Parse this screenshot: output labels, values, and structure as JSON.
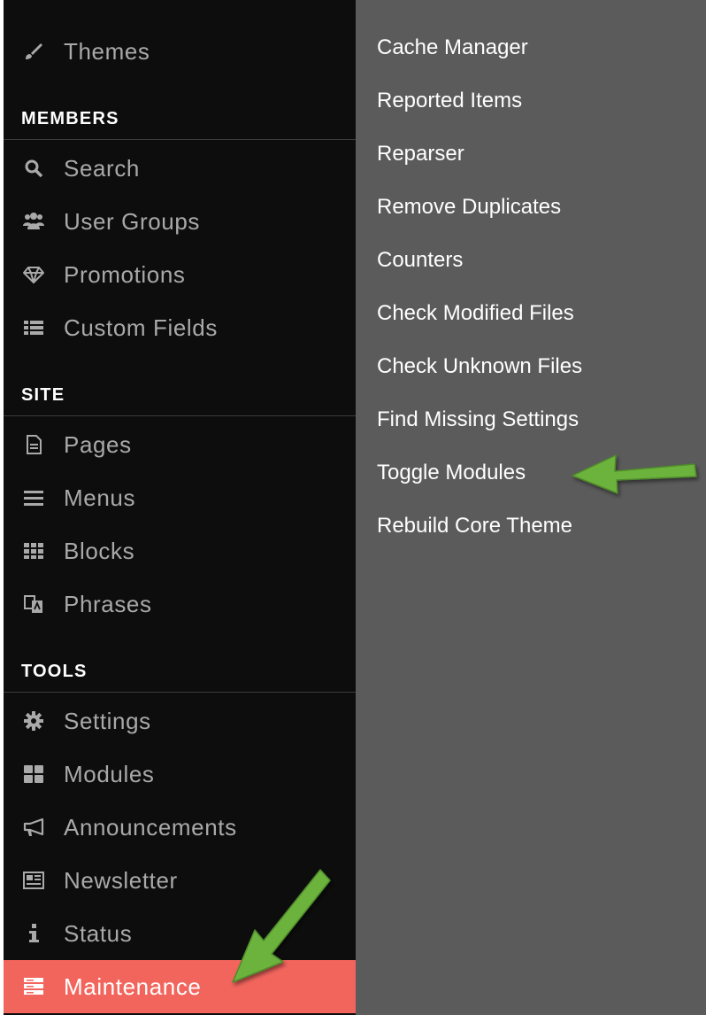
{
  "sidebar": {
    "top_item": {
      "label": "Themes",
      "icon": "brush-icon"
    },
    "sections": [
      {
        "title": "MEMBERS",
        "items": [
          {
            "label": "Search",
            "icon": "search-icon"
          },
          {
            "label": "User Groups",
            "icon": "users-icon"
          },
          {
            "label": "Promotions",
            "icon": "diamond-icon"
          },
          {
            "label": "Custom Fields",
            "icon": "list-icon"
          }
        ]
      },
      {
        "title": "SITE",
        "items": [
          {
            "label": "Pages",
            "icon": "file-icon"
          },
          {
            "label": "Menus",
            "icon": "bars-icon"
          },
          {
            "label": "Blocks",
            "icon": "grid-icon"
          },
          {
            "label": "Phrases",
            "icon": "translate-icon"
          }
        ]
      },
      {
        "title": "TOOLS",
        "items": [
          {
            "label": "Settings",
            "icon": "gear-icon"
          },
          {
            "label": "Modules",
            "icon": "modules-icon"
          },
          {
            "label": "Announcements",
            "icon": "megaphone-icon"
          },
          {
            "label": "Newsletter",
            "icon": "newspaper-icon"
          },
          {
            "label": "Status",
            "icon": "info-icon"
          },
          {
            "label": "Maintenance",
            "icon": "server-icon",
            "active": true
          }
        ]
      }
    ]
  },
  "submenu": {
    "items": [
      "Cache Manager",
      "Reported Items",
      "Reparser",
      "Remove Duplicates",
      "Counters",
      "Check Modified Files",
      "Check Unknown Files",
      "Find Missing Settings",
      "Toggle Modules",
      "Rebuild Core Theme"
    ]
  },
  "colors": {
    "sidebar_bg": "#0d0d0d",
    "panel_bg": "#5b5b5b",
    "active_bg": "#f2655d",
    "arrow": "#6cb33e"
  }
}
